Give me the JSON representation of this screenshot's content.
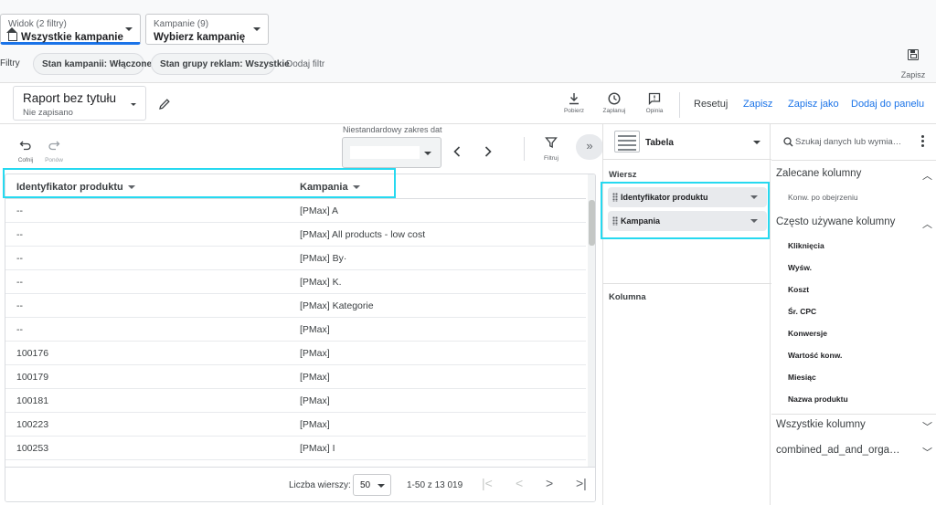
{
  "topbar": {
    "view_selector": {
      "small": "Widok (2 filtry)",
      "big": "Wszystkie kampanie"
    },
    "campaign_selector": {
      "small": "Kampanie (9)",
      "big": "Wybierz kampanię"
    },
    "filters_label": "Filtry",
    "chips": [
      "Stan kampanii: Włączone",
      "Stan grupy reklam: Wszystkie"
    ],
    "add_filter": "Dodaj filtr",
    "save_label": "Zapisz"
  },
  "report": {
    "title": "Raport bez tytułu",
    "subtitle": "Nie zapisano",
    "tools": {
      "download": "Pobierz",
      "schedule": "Zaplanuj",
      "feedback": "Opinia"
    },
    "actions": {
      "reset": "Resetuj",
      "save": "Zapisz",
      "save_as": "Zapisz jako",
      "add_to_panel": "Dodaj do panelu"
    }
  },
  "controls": {
    "undo": "Cofnij",
    "redo": "Ponów",
    "date_label": "Niestandardowy zakres dat",
    "filter": "Filtruj"
  },
  "table": {
    "headers": [
      "Identyfikator produktu",
      "Kampania"
    ],
    "rows": [
      [
        "--",
        "[PMax] A"
      ],
      [
        "--",
        "[PMax] All products - low cost"
      ],
      [
        "--",
        "[PMax] By·"
      ],
      [
        "--",
        "[PMax] K."
      ],
      [
        "--",
        "[PMax] Kategorie"
      ],
      [
        "--",
        "[PMax]"
      ],
      [
        "100176",
        "[PMax] "
      ],
      [
        "100179",
        "[PMax]"
      ],
      [
        "100181",
        "[PMax]"
      ],
      [
        "100223",
        "[PMax]"
      ],
      [
        "100253",
        "[PMax] I"
      ]
    ],
    "footer": {
      "rows_label": "Liczba wierszy:",
      "rows_value": "50",
      "range": "1-50 z 13 019"
    }
  },
  "config": {
    "viz_type": "Tabela",
    "row_title": "Wiersz",
    "row_dims": [
      "Identyfikator produktu",
      "Kampania"
    ],
    "column_title": "Kolumna"
  },
  "data_panel": {
    "search_placeholder": "Szukaj danych lub wymia…",
    "groups": [
      {
        "title": "Zalecane kolumny",
        "items": [
          "Konw. po obejrzeniu"
        ]
      },
      {
        "title": "Często używane kolumny",
        "items": [
          "Kliknięcia",
          "Wyśw.",
          "Koszt",
          "Śr. CPC",
          "Konwersje",
          "Wartość konw.",
          "Miesiąc",
          "Nazwa produktu"
        ]
      },
      {
        "title": "Wszystkie kolumny",
        "items": []
      },
      {
        "title": "combined_ad_and_orga…",
        "items": []
      }
    ]
  },
  "colors": {
    "accent": "#1a73e8",
    "highlight": "#26d9f0"
  }
}
